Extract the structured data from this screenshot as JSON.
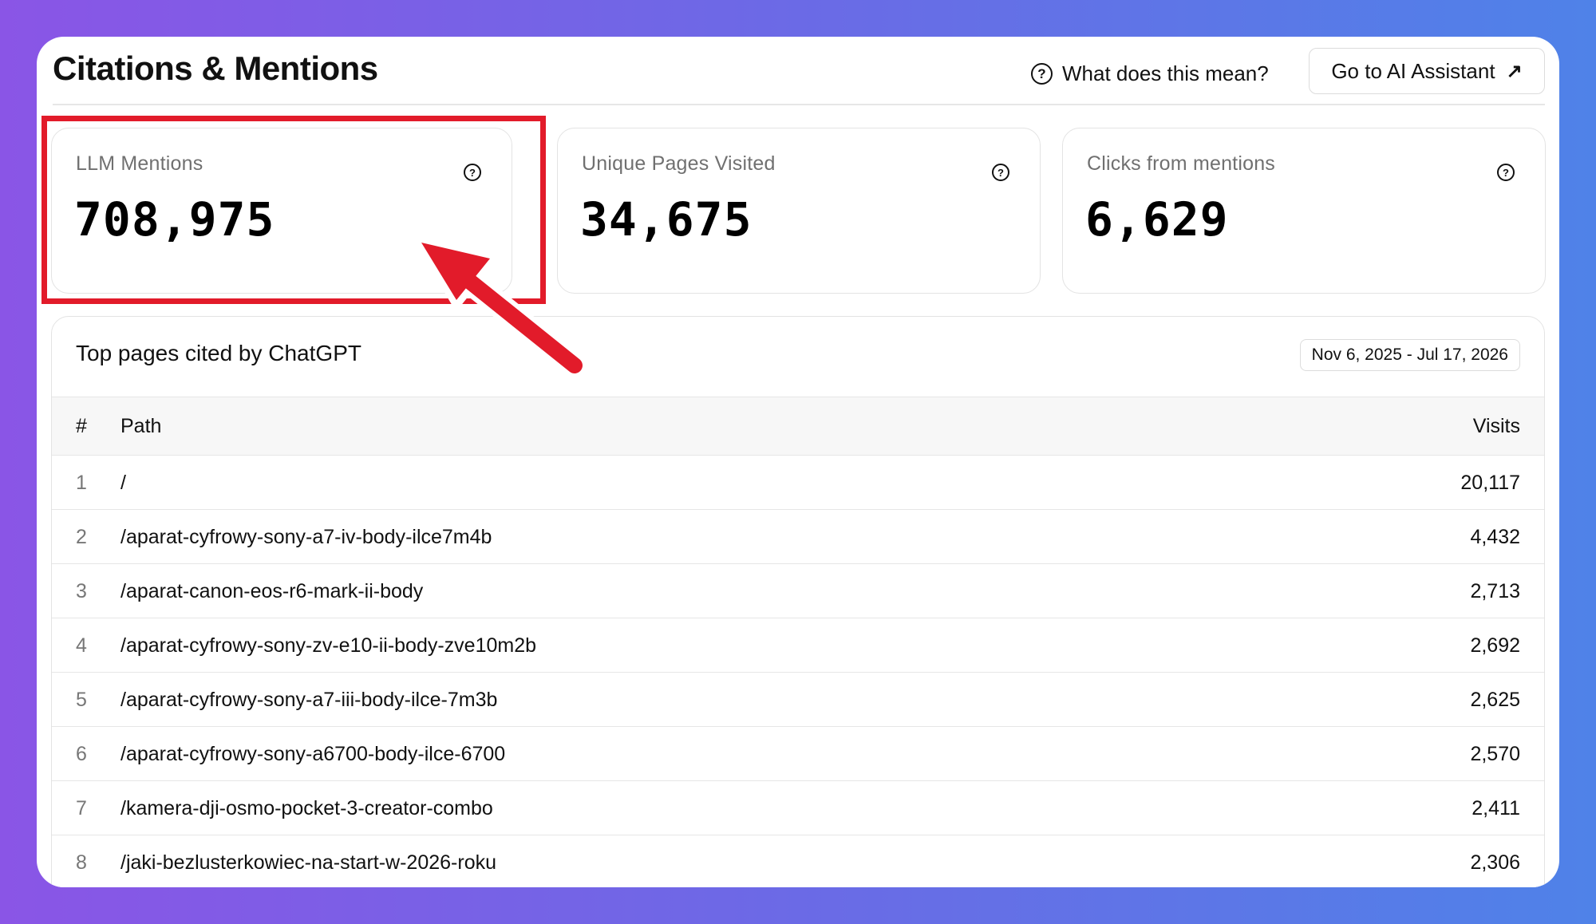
{
  "header": {
    "title": "Citations & Mentions",
    "help_label": "What does this mean?",
    "assistant_label": "Go to AI Assistant"
  },
  "metrics": [
    {
      "label": "LLM Mentions",
      "value": "708,975"
    },
    {
      "label": "Unique Pages Visited",
      "value": "34,675"
    },
    {
      "label": "Clicks from mentions",
      "value": "6,629"
    }
  ],
  "table": {
    "title": "Top pages cited by ChatGPT",
    "date_range": "Nov 6, 2025 - Jul 17, 2026",
    "columns": {
      "num": "#",
      "path": "Path",
      "visits": "Visits"
    },
    "rows": [
      {
        "num": "1",
        "path": "/",
        "visits": "20,117"
      },
      {
        "num": "2",
        "path": "/aparat-cyfrowy-sony-a7-iv-body-ilce7m4b",
        "visits": "4,432"
      },
      {
        "num": "3",
        "path": "/aparat-canon-eos-r6-mark-ii-body",
        "visits": "2,713"
      },
      {
        "num": "4",
        "path": "/aparat-cyfrowy-sony-zv-e10-ii-body-zve10m2b",
        "visits": "2,692"
      },
      {
        "num": "5",
        "path": "/aparat-cyfrowy-sony-a7-iii-body-ilce-7m3b",
        "visits": "2,625"
      },
      {
        "num": "6",
        "path": "/aparat-cyfrowy-sony-a6700-body-ilce-6700",
        "visits": "2,570"
      },
      {
        "num": "7",
        "path": "/kamera-dji-osmo-pocket-3-creator-combo",
        "visits": "2,411"
      },
      {
        "num": "8",
        "path": "/jaki-bezlusterkowiec-na-start-w-2026-roku",
        "visits": "2,306"
      }
    ]
  },
  "icons": {
    "help": "question-circle-icon",
    "external": "arrow-up-right-icon"
  },
  "colors": {
    "highlight": "#e21b2a",
    "gradient_start": "#8a55e6",
    "gradient_end": "#4f82e8"
  }
}
